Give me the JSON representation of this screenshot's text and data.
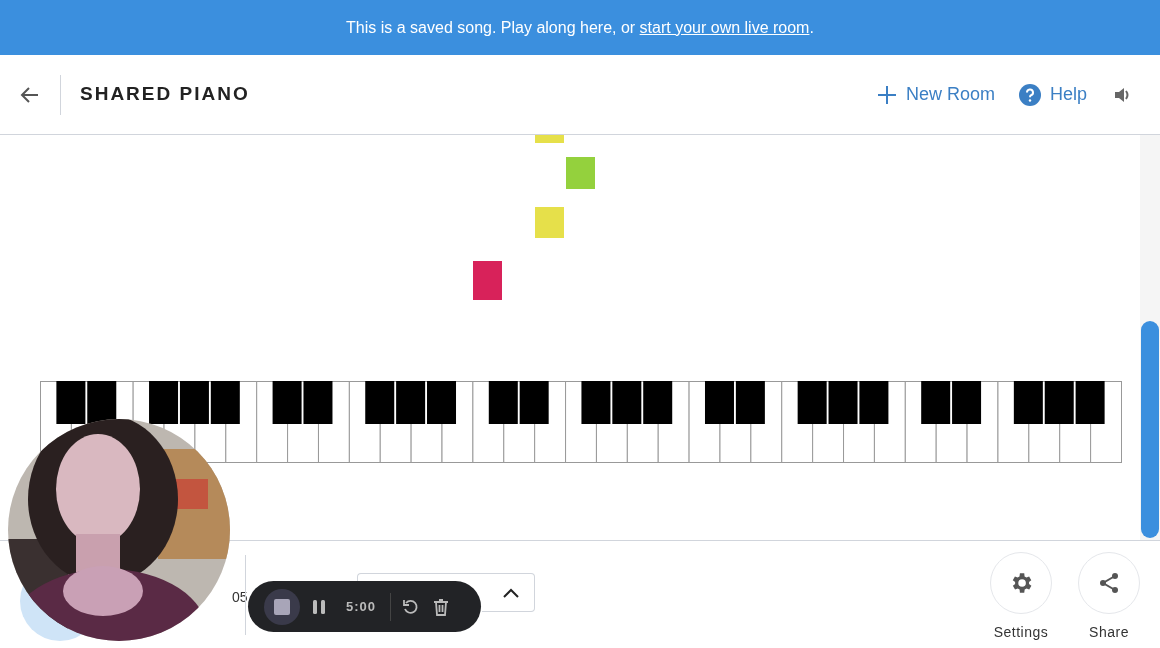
{
  "banner": {
    "text": "This is a saved song. Play along here, or ",
    "link": "start your own live room",
    "end": "."
  },
  "header": {
    "title": "SHARED PIANO",
    "actions": [
      {
        "kind": "new",
        "label": "New Room"
      },
      {
        "kind": "help",
        "label": "Help"
      }
    ]
  },
  "bottom_bar": {
    "user_text": "05",
    "recorder": {
      "time": "5:00"
    },
    "buttons": [
      {
        "kind": "settings",
        "label": "Settings"
      },
      {
        "kind": "share",
        "label": "Share"
      }
    ]
  }
}
